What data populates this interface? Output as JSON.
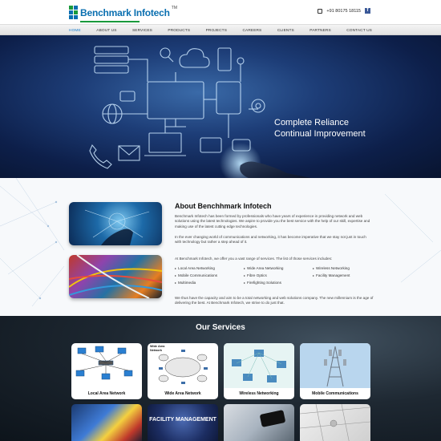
{
  "header": {
    "logo_text": "Benchmark Infotech",
    "logo_tm": "TM",
    "phone": "+91 80175 18115"
  },
  "nav": {
    "items": [
      "HOME",
      "ABOUT US",
      "SERVICES",
      "PRODUCTS",
      "PROJECTS",
      "CAREERS",
      "CLIENTS",
      "PARTNERS",
      "CONTACT US"
    ],
    "active": "HOME"
  },
  "hero": {
    "line1": "Complete Reliance",
    "line2": "Continual Improvement"
  },
  "about": {
    "title": "About Benchhmark Infotech",
    "p1": "Benchmark Infotech has been formed by professionals who have years of experience in providing network and web solutions using the latest technologies. We aspire to provide you the best service with the help of our skill, expertise and making use of the latest cutting edge technologies.",
    "p2": "In the ever changing world of communications and networking, it has become imperative that we stay not just in touch with technology but rather a step ahead of it.",
    "p3": "At Benchmark Infotech, we offer you a vast range of services. The list of those services includes:",
    "services": [
      "Local Area Networking",
      "Wide Area Networking",
      "Wireless Networking",
      "Mobile Communications",
      "Fibre Optics",
      "Facility Management",
      "Multimedia",
      "Firefighting Solutions"
    ],
    "p4": "We thus have the capacity and aim to be a total networking and web solutions company. The new millennium is the age of delivering the best. At Benchmark Infotech, we strive to do just that."
  },
  "services_section": {
    "title": "Our Services",
    "cards": [
      "Local Area Network",
      "Wide Area Network",
      "Wireless Networking",
      "Mobile Communications"
    ],
    "facility_text": "FACILITY MANAGEMENT",
    "wan_img_label": "Wide Area Network"
  },
  "colors": {
    "brand_blue": "#0a6fb0",
    "nav_active": "#1a7fd0"
  }
}
